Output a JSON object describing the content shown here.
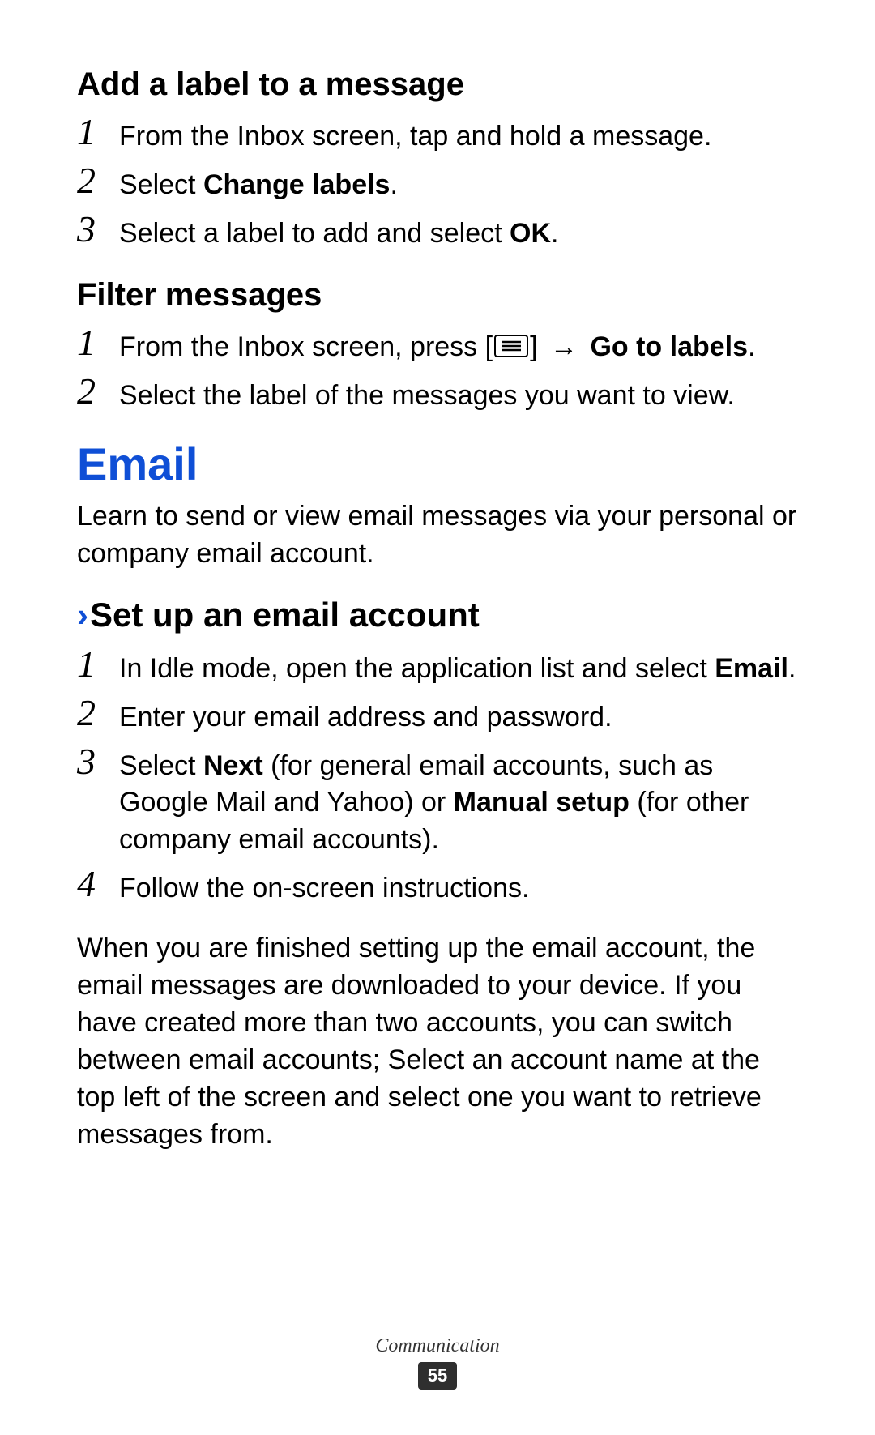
{
  "section1": {
    "title": "Add a label to a message",
    "steps": {
      "s1": {
        "num": "1",
        "text": "From the Inbox screen, tap and hold a message."
      },
      "s2": {
        "num": "2",
        "pre": "Select ",
        "bold": "Change labels",
        "post": "."
      },
      "s3": {
        "num": "3",
        "pre": "Select a label to add and select ",
        "bold": "OK",
        "post": "."
      }
    }
  },
  "section2": {
    "title": "Filter messages",
    "steps": {
      "s1": {
        "num": "1",
        "pre": "From the Inbox screen, press [",
        "arrow": " → ",
        "bold": "Go to labels",
        "post": "."
      },
      "s2": {
        "num": "2",
        "text": "Select the label of the messages you want to view."
      }
    }
  },
  "feature": {
    "title": "Email",
    "intro": "Learn to send or view email messages via your personal or company email account."
  },
  "task": {
    "title": "Set up an email account",
    "steps": {
      "s1": {
        "num": "1",
        "pre": "In Idle mode, open the application list and select ",
        "bold": "Email",
        "post": "."
      },
      "s2": {
        "num": "2",
        "text": "Enter your email address and password."
      },
      "s3": {
        "num": "3",
        "pre": "Select ",
        "bold1": "Next",
        "mid": " (for general email accounts, such as Google Mail and Yahoo) or ",
        "bold2": "Manual setup",
        "post": " (for other company email accounts)."
      },
      "s4": {
        "num": "4",
        "text": "Follow the on-screen instructions."
      }
    },
    "outro": "When you are finished setting up the email account, the email messages are downloaded to your device. If you have created more than two accounts, you can switch between email accounts; Select an account name at the top left of the screen and select one you want to retrieve messages from."
  },
  "footer": {
    "section": "Communication",
    "page": "55"
  }
}
